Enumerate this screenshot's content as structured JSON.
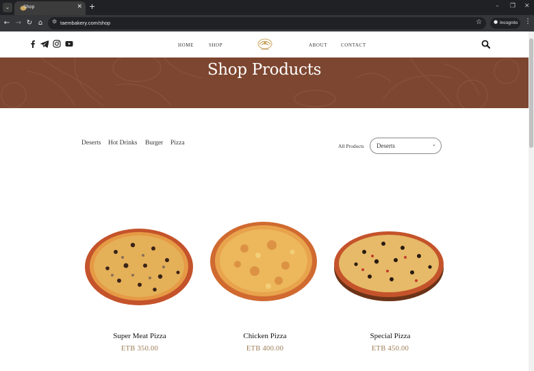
{
  "browser": {
    "tab_title": "Shop",
    "url": "taembakery.com/shop",
    "incognito_label": "Incognito"
  },
  "header": {
    "nav": [
      "HOME",
      "SHOP",
      "ABOUT",
      "CONTACT"
    ]
  },
  "hero": {
    "title": "Shop Products"
  },
  "filters": {
    "categories": [
      "Deserts",
      "Hot Drinks",
      "Burger",
      "Pizza"
    ],
    "all_products_label": "All Products",
    "select_value": "Deserts"
  },
  "products": [
    {
      "name": "Super Meat Pizza",
      "price": "ETB 350.00"
    },
    {
      "name": "Chicken Pizza",
      "price": "ETB 400.00"
    },
    {
      "name": "Special Pizza",
      "price": "ETB 450.00"
    }
  ],
  "icons": {
    "social": [
      "facebook-icon",
      "telegram-icon",
      "instagram-icon",
      "youtube-icon"
    ],
    "search": "search-icon"
  },
  "colors": {
    "hero_bg": "#7d4630",
    "price": "#9b7b52",
    "browser_dark": "#202124"
  }
}
